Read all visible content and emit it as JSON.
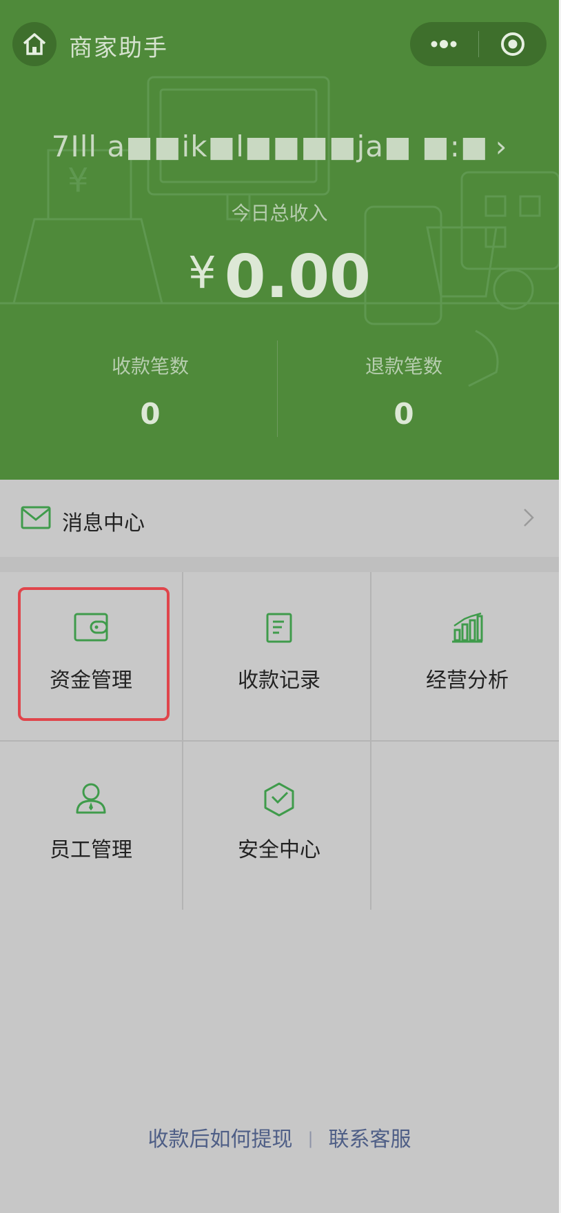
{
  "header": {
    "app_title": "商家助手",
    "home_icon": "home-icon",
    "more_icon": "more-dots-icon",
    "close_icon": "target-close-icon"
  },
  "summary": {
    "merchant_name": "7Ill a■■ik■l■■■■ja■ ■:■",
    "merchant_chevron": "›",
    "income_label": "今日总收入",
    "currency": "¥",
    "income_amount": "0.00",
    "stats": [
      {
        "label": "收款笔数",
        "value": "0"
      },
      {
        "label": "退款笔数",
        "value": "0"
      }
    ]
  },
  "message_center": {
    "label": "消息中心",
    "icon": "envelope-icon",
    "chevron": "›"
  },
  "grid": {
    "items": [
      {
        "label": "资金管理",
        "icon": "wallet-icon",
        "highlighted": true
      },
      {
        "label": "收款记录",
        "icon": "receipt-record-icon"
      },
      {
        "label": "经营分析",
        "icon": "bar-chart-icon"
      },
      {
        "label": "员工管理",
        "icon": "staff-person-icon"
      },
      {
        "label": "安全中心",
        "icon": "shield-check-icon"
      }
    ]
  },
  "footer": {
    "link_withdraw": "收款后如何提现",
    "separator": "|",
    "link_support": "联系客服"
  },
  "colors": {
    "header_green": "#4f8a3a",
    "icon_green": "#3f9b4b",
    "highlight_red": "#e0454b",
    "link_blue": "#4e5e86"
  }
}
